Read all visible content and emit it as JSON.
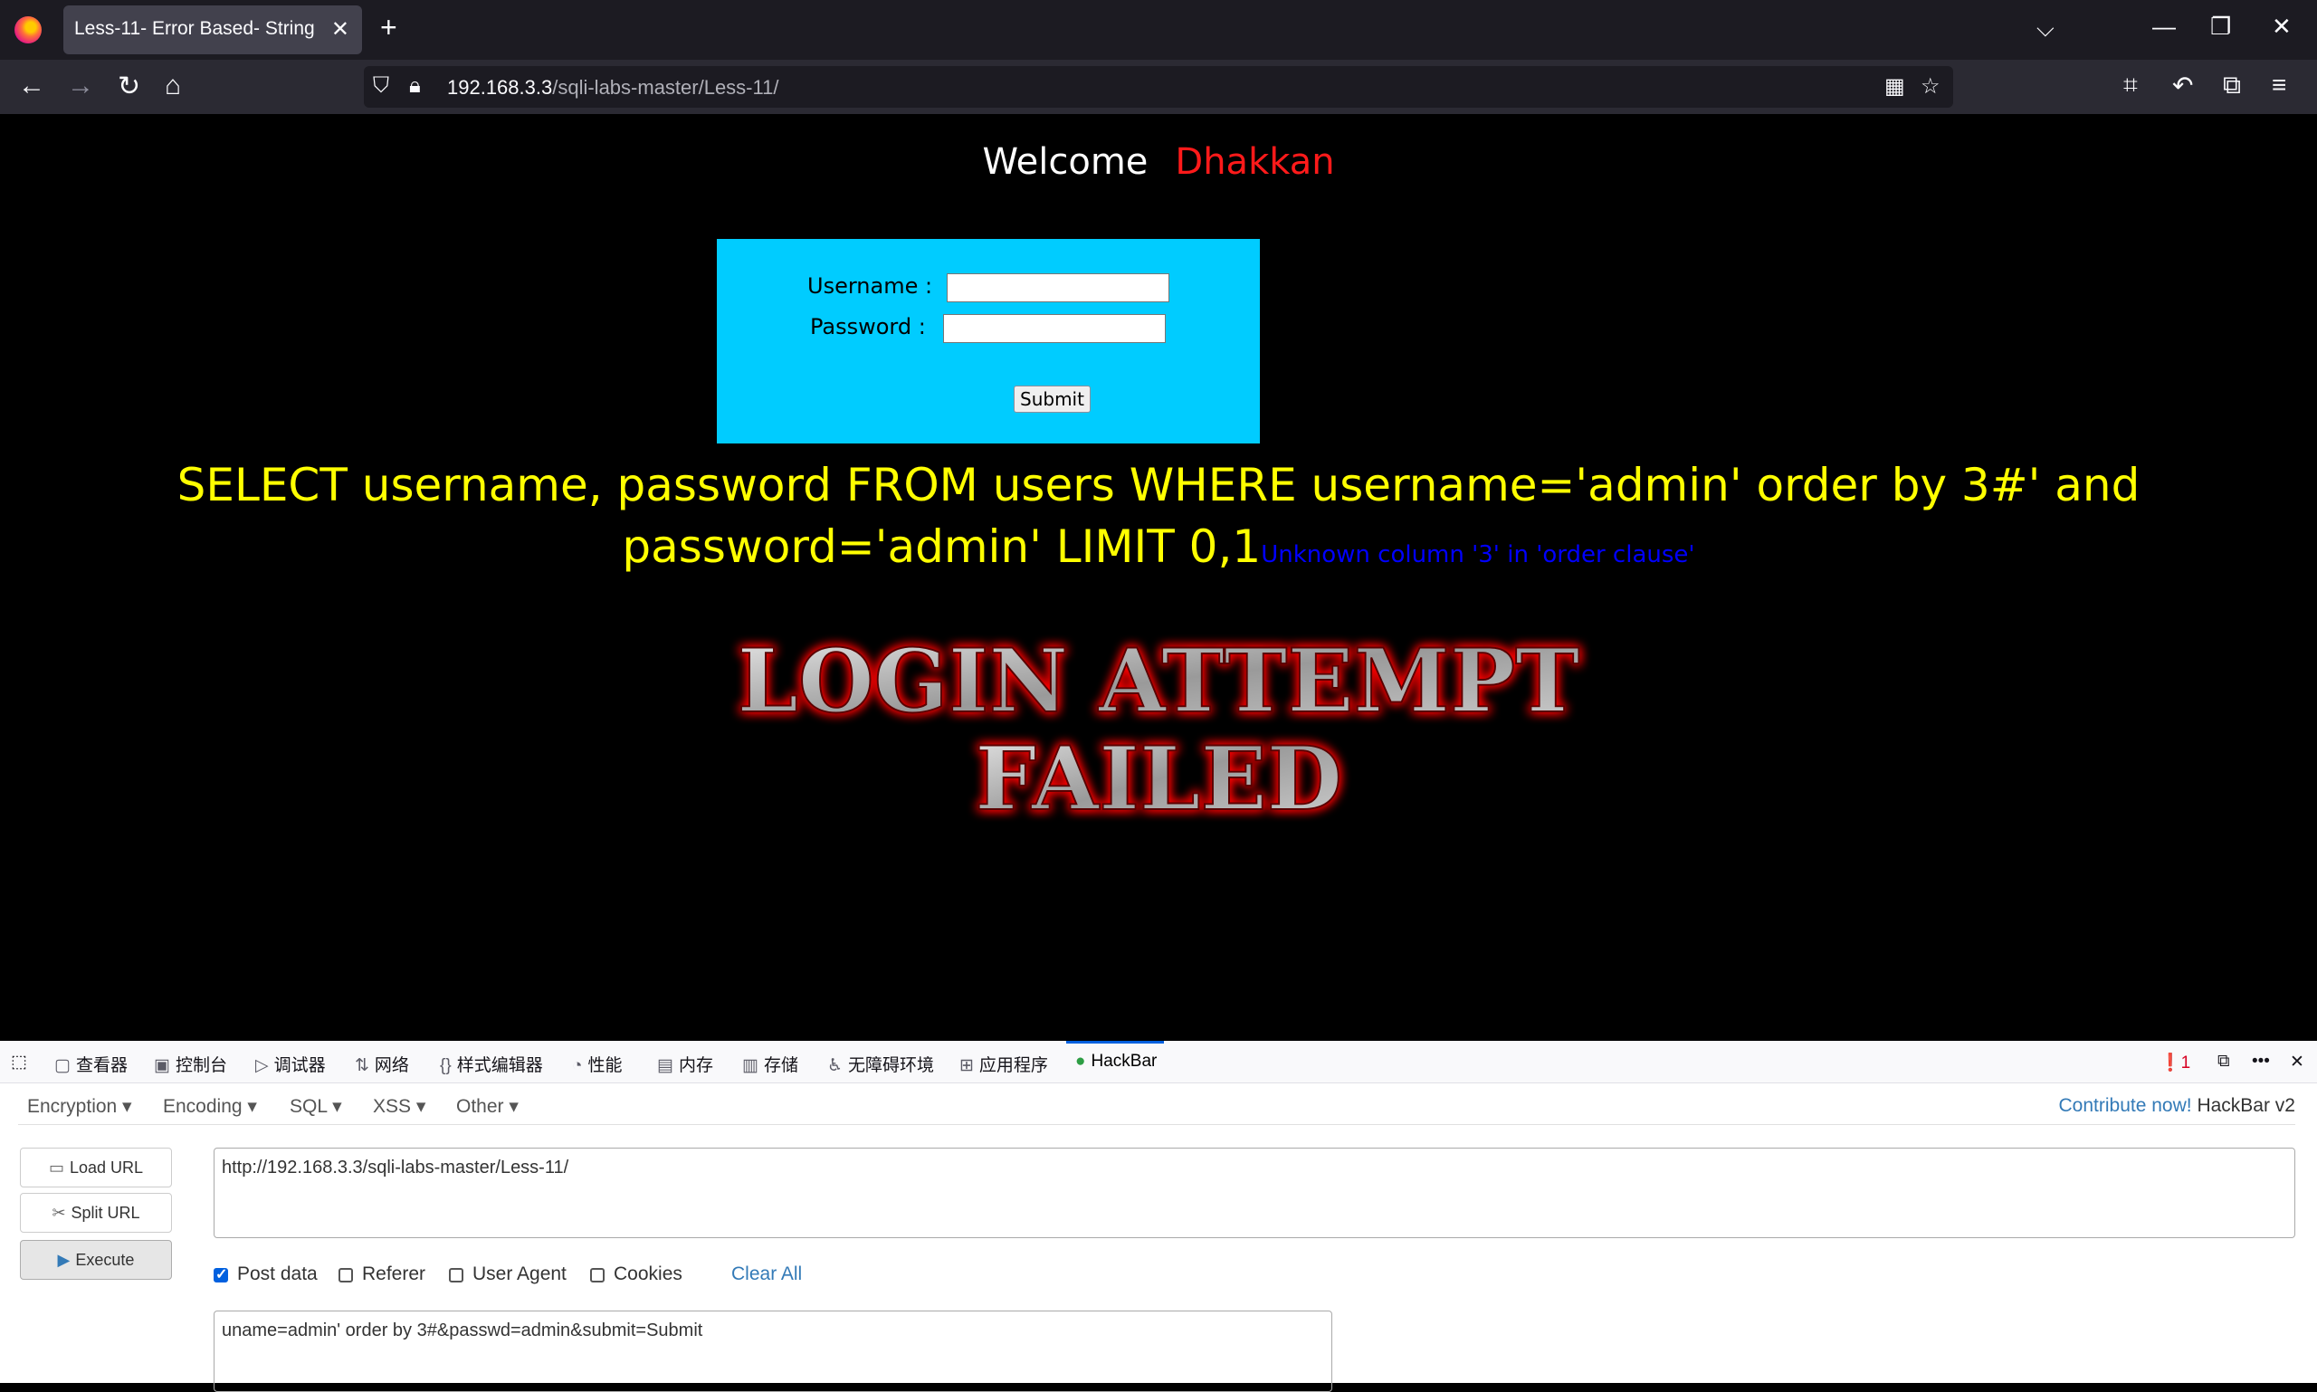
{
  "browser": {
    "tab_title": "Less-11- Error Based- String",
    "url_host": "192.168.3.3",
    "url_path": "/sqli-labs-master/Less-11/"
  },
  "page": {
    "welcome": "Welcome",
    "name": "Dhakkan",
    "username_label": "Username :",
    "password_label": "Password :",
    "submit_label": "Submit",
    "query_text": "SELECT username, password FROM users WHERE username='admin' order by 3#' and password='admin' LIMIT 0,1",
    "error_text": "Unknown column '3' in 'order clause'",
    "banner_line1": "LOGIN ATTEMPT",
    "banner_line2": "FAILED"
  },
  "devtools": {
    "tabs": [
      "查看器",
      "控制台",
      "调试器",
      "网络",
      "样式编辑器",
      "性能",
      "内存",
      "存储",
      "无障碍环境",
      "应用程序",
      "HackBar"
    ],
    "error_count": "1"
  },
  "hackbar": {
    "menu": [
      "Encryption",
      "Encoding",
      "SQL",
      "XSS",
      "Other"
    ],
    "contribute": "Contribute now!",
    "version": "HackBar v2",
    "load_url": "Load URL",
    "split_url": "Split URL",
    "execute": "Execute",
    "url_value": "http://192.168.3.3/sqli-labs-master/Less-11/",
    "post_data_label": "Post data",
    "referer_label": "Referer",
    "user_agent_label": "User Agent",
    "cookies_label": "Cookies",
    "clear_all": "Clear All",
    "post_value": "uname=admin' order by 3#&passwd=admin&submit=Submit",
    "post_data_checked": true
  }
}
